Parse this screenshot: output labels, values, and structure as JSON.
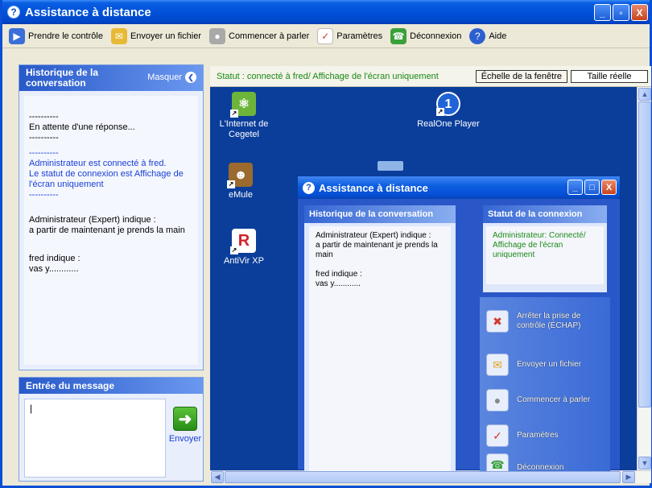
{
  "window": {
    "title": "Assistance à distance",
    "controls": [
      "_",
      "▫",
      "X"
    ]
  },
  "toolbar": {
    "items": [
      {
        "label": "Prendre le contrôle",
        "icon": "take-control-icon"
      },
      {
        "label": "Envoyer un fichier",
        "icon": "send-file-icon"
      },
      {
        "label": "Commencer à parler",
        "icon": "microphone-icon"
      },
      {
        "label": "Paramètres",
        "icon": "settings-icon"
      },
      {
        "label": "Déconnexion",
        "icon": "disconnect-icon"
      },
      {
        "label": "Aide",
        "icon": "help-icon"
      }
    ]
  },
  "history": {
    "title": "Historique de la conversation",
    "hide_label": "Masquer",
    "lines": {
      "sep1": "----------",
      "waiting": "En attente d'une réponse...",
      "sep2": "----------",
      "sep3": "----------",
      "connected": "Administrateur est connecté à fred.",
      "status": "Le statut de connexion est Affichage de l'écran uniquement",
      "sep4": "----------",
      "admin_says": "Administrateur (Expert) indique :",
      "admin_msg": " a partir de maintenant je prends la main",
      "fred_says": "fred indique :",
      "fred_msg": " vas y............"
    }
  },
  "message": {
    "title": "Entrée du message",
    "value": "|",
    "send_label": "Envoyer"
  },
  "status_bar": {
    "text": "Statut : connecté à fred/ Affichage de l'écran uniquement",
    "scale_btn": "Échelle de la fenêtre",
    "actual_btn": "Taille réelle"
  },
  "desktop": {
    "icons": [
      {
        "label": "L'Internet de Cegetel",
        "name": "desktop-icon-cegetel"
      },
      {
        "label": "RealOne Player",
        "name": "desktop-icon-realone"
      },
      {
        "label": "eMule",
        "name": "desktop-icon-emule"
      },
      {
        "label": "AntiVir XP",
        "name": "desktop-icon-antivir"
      }
    ]
  },
  "inner": {
    "title": "Assistance à distance",
    "history_title": "Historique de la conversation",
    "history": {
      "admin_says": "Administrateur (Expert) indique :",
      "admin_msg": "a partir de maintenant je prends la main",
      "fred_says": "fred indique :",
      "fred_msg": "vas y............"
    },
    "status_title": "Statut de la connexion",
    "status_text": "Administrateur: Connecté/ Affichage de l'écran uniquement",
    "actions": [
      {
        "label": "Arrêter la prise de contrôle (ÉCHAP)",
        "icon": "stop-control-icon"
      },
      {
        "label": "Envoyer un fichier",
        "icon": "send-file-icon"
      },
      {
        "label": "Commencer à parler",
        "icon": "microphone-icon"
      },
      {
        "label": "Paramètres",
        "icon": "settings-icon"
      },
      {
        "label": "Déconnexion",
        "icon": "disconnect-icon"
      }
    ]
  },
  "colors": {
    "title_blue": "#0052d9",
    "status_green": "#1a8a16",
    "desktop_bg": "#0b3e9a"
  }
}
